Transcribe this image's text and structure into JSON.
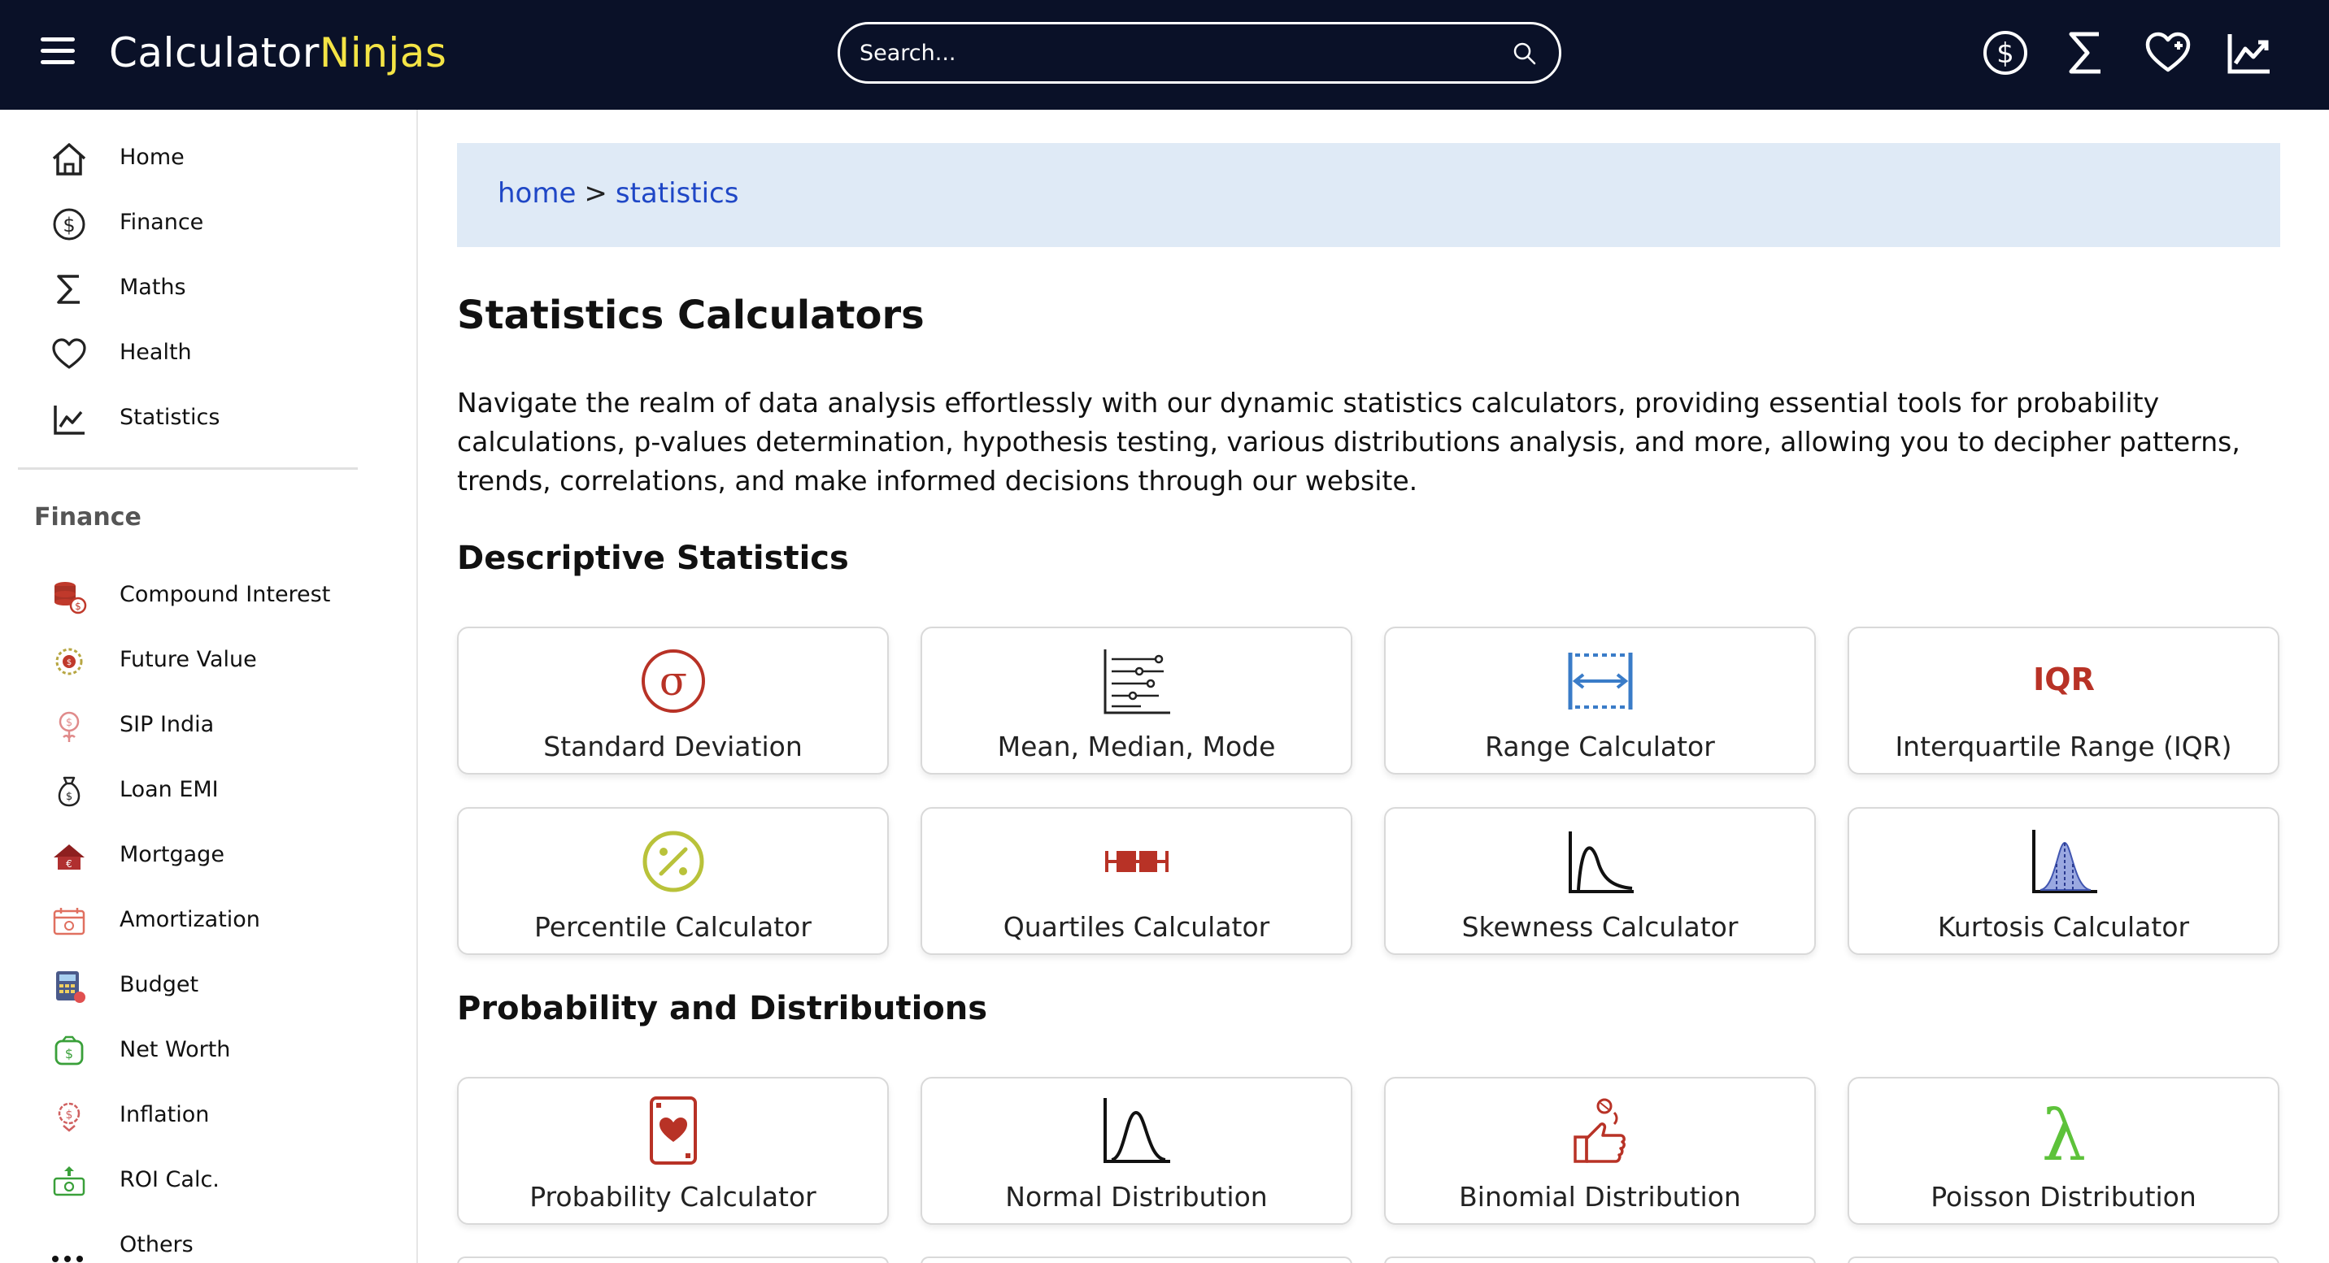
{
  "header": {
    "logo_part1": "Calculator",
    "logo_part2": "Ninjas",
    "search_placeholder": "Search...",
    "icons": [
      "dollar-icon",
      "sigma-icon",
      "heart-icon",
      "chart-line-icon"
    ]
  },
  "sidebar": {
    "nav": [
      {
        "label": "Home",
        "icon": "home-icon"
      },
      {
        "label": "Finance",
        "icon": "dollar-icon"
      },
      {
        "label": "Maths",
        "icon": "sigma-icon"
      },
      {
        "label": "Health",
        "icon": "heart-icon"
      },
      {
        "label": "Statistics",
        "icon": "chart-line-icon"
      }
    ],
    "finance_heading": "Finance",
    "finance_items": [
      {
        "label": "Compound Interest",
        "icon": "coins-icon"
      },
      {
        "label": "Future Value",
        "icon": "future-value-icon"
      },
      {
        "label": "SIP India",
        "icon": "sip-icon"
      },
      {
        "label": "Loan EMI",
        "icon": "money-bag-icon"
      },
      {
        "label": "Mortgage",
        "icon": "house-icon"
      },
      {
        "label": "Amortization",
        "icon": "calendar-money-icon"
      },
      {
        "label": "Budget",
        "icon": "calculator-icon"
      },
      {
        "label": "Net Worth",
        "icon": "wallet-icon"
      },
      {
        "label": "Inflation",
        "icon": "inflation-icon"
      },
      {
        "label": "ROI Calc.",
        "icon": "roi-icon"
      },
      {
        "label": "Others",
        "icon": "more-dots-icon"
      }
    ]
  },
  "breadcrumb": {
    "home": "home",
    "separator": ">",
    "current": "statistics"
  },
  "main": {
    "title": "Statistics Calculators",
    "intro": "Navigate the realm of data analysis effortlessly with our dynamic statistics calculators, providing essential tools for probability calculations, p-values determination, hypothesis testing, various distributions analysis, and more, allowing you to decipher patterns, trends, correlations, and make informed decisions through our website.",
    "sections": [
      {
        "title": "Descriptive Statistics",
        "cards": [
          {
            "label": "Standard Deviation",
            "icon": "sigma-circle-icon"
          },
          {
            "label": "Mean, Median, Mode",
            "icon": "data-lines-icon"
          },
          {
            "label": "Range Calculator",
            "icon": "range-icon"
          },
          {
            "label": "Interquartile Range (IQR)",
            "icon": "iqr-icon",
            "icon_text": "IQR"
          },
          {
            "label": "Percentile Calculator",
            "icon": "percent-circle-icon"
          },
          {
            "label": "Quartiles Calculator",
            "icon": "boxplot-icon"
          },
          {
            "label": "Skewness Calculator",
            "icon": "skewness-curve-icon"
          },
          {
            "label": "Kurtosis Calculator",
            "icon": "kurtosis-curve-icon"
          }
        ]
      },
      {
        "title": "Probability and Distributions",
        "cards": [
          {
            "label": "Probability Calculator",
            "icon": "playing-card-icon"
          },
          {
            "label": "Normal Distribution",
            "icon": "bell-curve-icon"
          },
          {
            "label": "Binomial Distribution",
            "icon": "coin-toss-icon"
          },
          {
            "label": "Poisson Distribution",
            "icon": "lambda-icon",
            "icon_text": "λ"
          }
        ]
      }
    ]
  },
  "colors": {
    "header_bg": "#0a1128",
    "logo_accent": "#f4e445",
    "breadcrumb_bg": "#dfeaf6",
    "link": "#1f47c6"
  }
}
